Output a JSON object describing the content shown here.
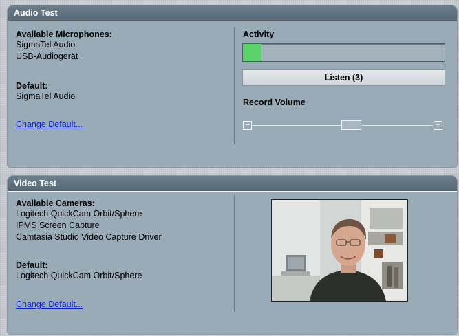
{
  "audio": {
    "title": "Audio Test",
    "microphones_label": "Available Microphones:",
    "microphones": [
      "SigmaTel Audio",
      "USB-Audiogerät"
    ],
    "default_label": "Default:",
    "default_value": "SigmaTel Audio",
    "change_link": "Change Default...",
    "activity_label": "Activity",
    "activity_level": 0.09,
    "listen_button": "Listen (3)",
    "record_volume_label": "Record Volume",
    "volume_level": 0.55
  },
  "video": {
    "title": "Video Test",
    "cameras_label": "Available Cameras:",
    "cameras": [
      "Logitech QuickCam Orbit/Sphere",
      "IPMS Screen Capture",
      "Camtasia Studio Video Capture Driver"
    ],
    "default_label": "Default:",
    "default_value": "Logitech QuickCam Orbit/Sphere",
    "change_link": "Change Default..."
  }
}
